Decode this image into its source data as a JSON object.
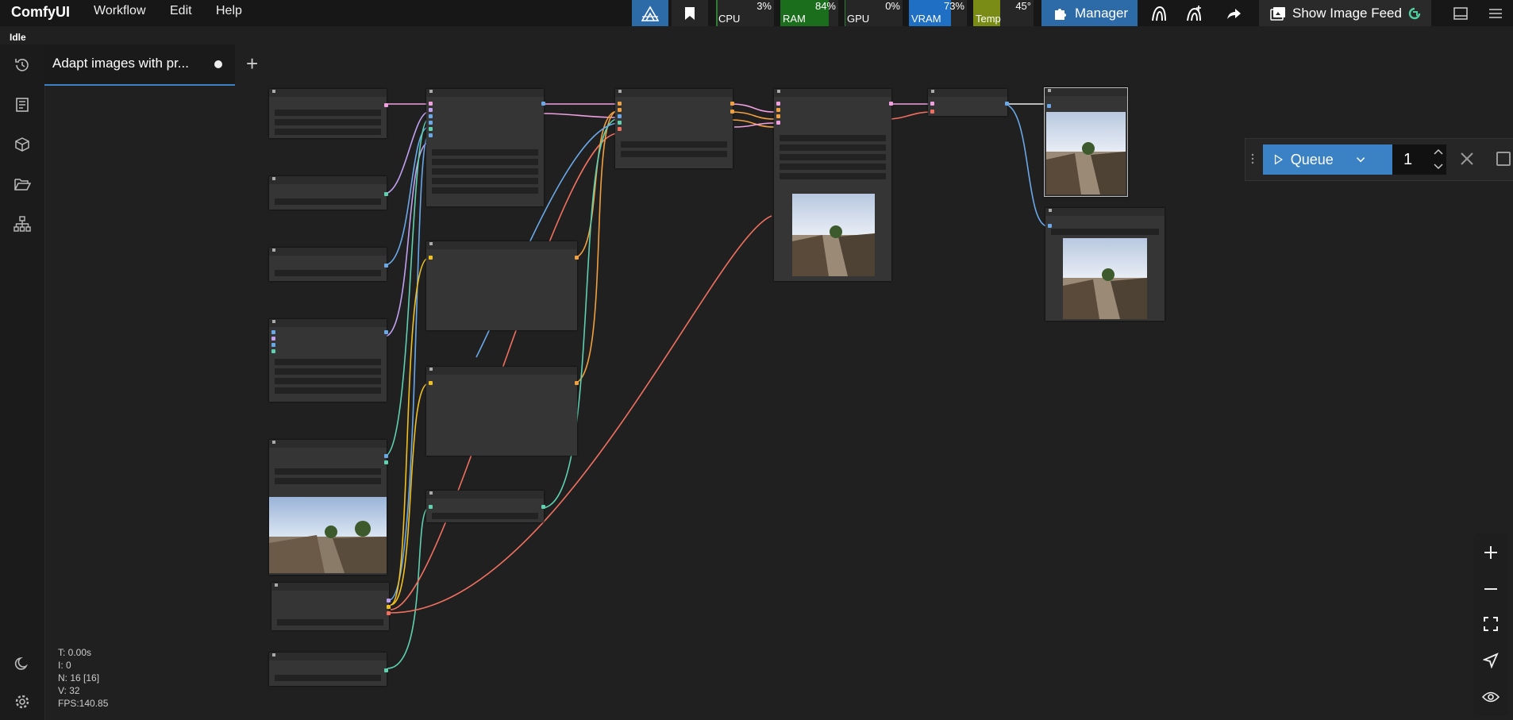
{
  "app": {
    "title": "ComfyUI"
  },
  "menu": {
    "workflow": "Workflow",
    "edit": "Edit",
    "help": "Help"
  },
  "monitors": {
    "cpu": {
      "label": "CPU",
      "value": "3%",
      "percent": 3,
      "color": "#2e7d32"
    },
    "ram": {
      "label": "RAM",
      "value": "84%",
      "percent": 84,
      "color": "#1b6e1b"
    },
    "gpu": {
      "label": "GPU",
      "value": "0%",
      "percent": 0,
      "color": "#2e7d32"
    },
    "vram": {
      "label": "VRAM",
      "value": "73%",
      "percent": 73,
      "color": "#1f6fc5"
    },
    "temp": {
      "label": "Temp",
      "value": "45°",
      "percent": 45,
      "color": "#7a8c16"
    }
  },
  "toolbar": {
    "manager_label": "Manager",
    "feed_label": "Show Image Feed"
  },
  "status": {
    "text": "Idle"
  },
  "tabs": [
    {
      "label": "Adapt images with pr..."
    }
  ],
  "queue": {
    "label": "Queue",
    "count": "1"
  },
  "stats": {
    "t": "T: 0.00s",
    "i": "I: 0",
    "n": "N: 16 [16]",
    "v": "V: 32",
    "fps": "FPS:140.85"
  },
  "colors": {
    "accent": "#3b82c4",
    "link_pink": "#f0a0e0",
    "link_blue": "#6aa8e8",
    "link_teal": "#5fd0b0",
    "link_yellow": "#f0c020",
    "link_orange": "#f0a040",
    "link_red": "#f07060",
    "link_purple": "#c0a0f0"
  }
}
